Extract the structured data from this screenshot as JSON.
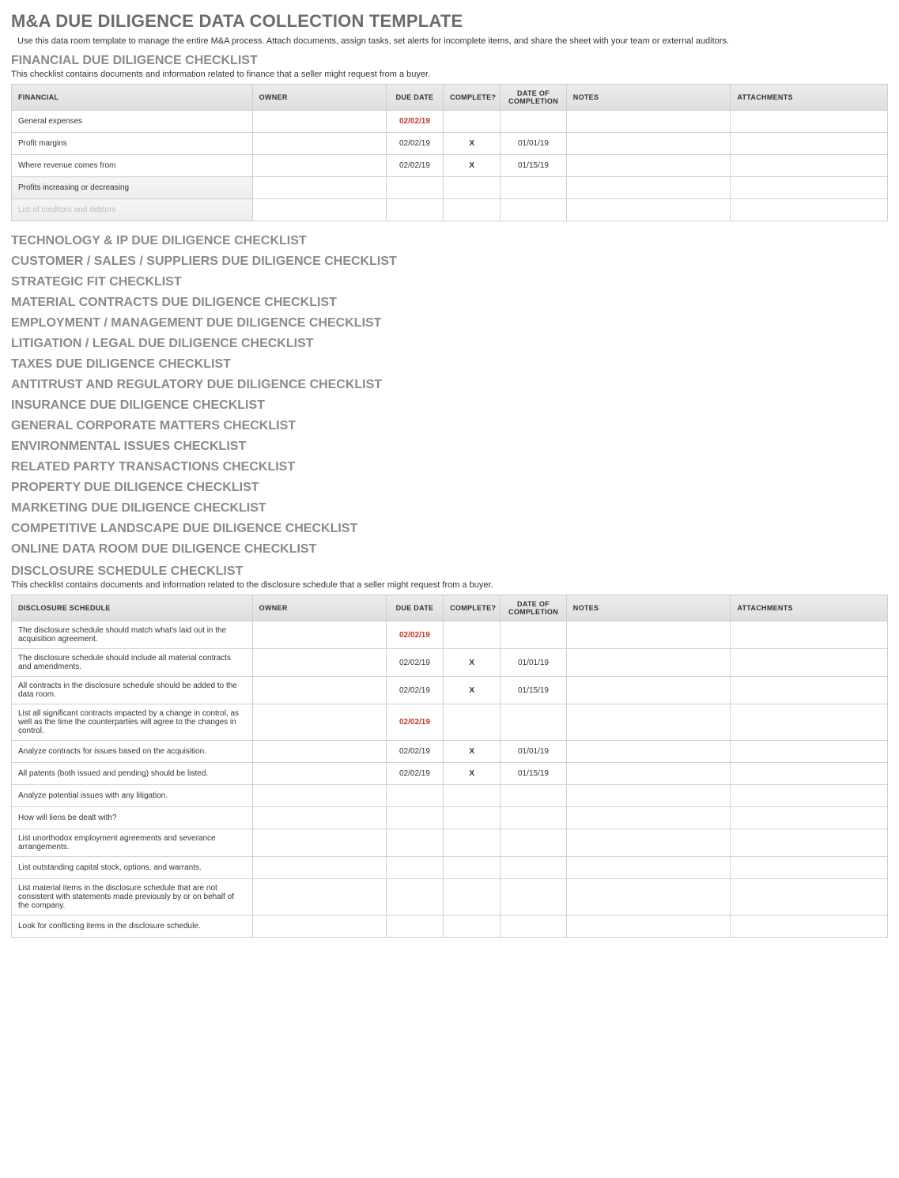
{
  "title": "M&A DUE DILIGENCE DATA COLLECTION TEMPLATE",
  "intro": "Use this data room template to manage the entire M&A process. Attach documents, assign tasks, set alerts for incomplete items, and share the sheet with your team or external auditors.",
  "financial": {
    "heading": "FINANCIAL DUE DILIGENCE CHECKLIST",
    "desc": "This checklist contains documents and information related to finance that a seller might request from a buyer.",
    "columns": {
      "item": "FINANCIAL",
      "owner": "OWNER",
      "due": "DUE DATE",
      "complete": "COMPLETE?",
      "doc": "DATE OF COMPLETION",
      "notes": "NOTES",
      "attach": "ATTACHMENTS"
    },
    "rows": [
      {
        "item": "General expenses",
        "owner": "",
        "due": "02/02/19",
        "due_red": true,
        "complete": "",
        "doc": "",
        "notes": "",
        "attach": ""
      },
      {
        "item": "Profit margins",
        "owner": "",
        "due": "02/02/19",
        "due_red": false,
        "complete": "X",
        "doc": "01/01/19",
        "notes": "",
        "attach": ""
      },
      {
        "item": "Where revenue comes from",
        "owner": "",
        "due": "02/02/19",
        "due_red": false,
        "complete": "X",
        "doc": "01/15/19",
        "notes": "",
        "attach": ""
      },
      {
        "item": "Profits increasing or decreasing",
        "owner": "",
        "due": "",
        "due_red": false,
        "complete": "",
        "doc": "",
        "notes": "",
        "attach": "",
        "grad": true
      },
      {
        "item": "List of creditors and debtors",
        "owner": "",
        "due": "",
        "due_red": false,
        "complete": "",
        "doc": "",
        "notes": "",
        "attach": "",
        "faded": true,
        "grad": true
      }
    ]
  },
  "checklists": [
    "TECHNOLOGY & IP DUE DILIGENCE CHECKLIST",
    "CUSTOMER / SALES / SUPPLIERS DUE DILIGENCE CHECKLIST",
    "STRATEGIC FIT CHECKLIST",
    "MATERIAL CONTRACTS DUE DILIGENCE CHECKLIST",
    "EMPLOYMENT / MANAGEMENT DUE DILIGENCE CHECKLIST",
    "LITIGATION / LEGAL DUE DILIGENCE CHECKLIST",
    "TAXES DUE DILIGENCE CHECKLIST",
    "ANTITRUST AND REGULATORY DUE DILIGENCE CHECKLIST",
    "INSURANCE DUE DILIGENCE CHECKLIST",
    "GENERAL CORPORATE MATTERS CHECKLIST",
    "ENVIRONMENTAL ISSUES CHECKLIST",
    "RELATED PARTY TRANSACTIONS CHECKLIST",
    "PROPERTY DUE DILIGENCE CHECKLIST",
    "MARKETING DUE DILIGENCE CHECKLIST",
    "COMPETITIVE LANDSCAPE DUE DILIGENCE CHECKLIST",
    "ONLINE DATA ROOM DUE DILIGENCE CHECKLIST"
  ],
  "disclosure": {
    "heading": "DISCLOSURE SCHEDULE CHECKLIST",
    "desc": "This checklist contains documents and information related to the disclosure schedule that a seller might request from a buyer.",
    "columns": {
      "item": "DISCLOSURE SCHEDULE",
      "owner": "OWNER",
      "due": "DUE DATE",
      "complete": "COMPLETE?",
      "doc": "DATE OF COMPLETION",
      "notes": "NOTES",
      "attach": "ATTACHMENTS"
    },
    "rows": [
      {
        "item": "The disclosure schedule should match what's laid out in the acquisition agreement.",
        "owner": "",
        "due": "02/02/19",
        "due_red": true,
        "complete": "",
        "doc": "",
        "notes": "",
        "attach": ""
      },
      {
        "item": "The disclosure schedule should include all material contracts and amendments.",
        "owner": "",
        "due": "02/02/19",
        "due_red": false,
        "complete": "X",
        "doc": "01/01/19",
        "notes": "",
        "attach": ""
      },
      {
        "item": "All contracts in the disclosure schedule should be added to the data room.",
        "owner": "",
        "due": "02/02/19",
        "due_red": false,
        "complete": "X",
        "doc": "01/15/19",
        "notes": "",
        "attach": ""
      },
      {
        "item": "List all significant contracts impacted by a change in control, as well as the time the counterparties will agree to the changes in control.",
        "owner": "",
        "due": "02/02/19",
        "due_red": true,
        "complete": "",
        "doc": "",
        "notes": "",
        "attach": ""
      },
      {
        "item": "Analyze contracts for issues based on the acquisition.",
        "owner": "",
        "due": "02/02/19",
        "due_red": false,
        "complete": "X",
        "doc": "01/01/19",
        "notes": "",
        "attach": ""
      },
      {
        "item": "All patents (both issued and pending) should be listed.",
        "owner": "",
        "due": "02/02/19",
        "due_red": false,
        "complete": "X",
        "doc": "01/15/19",
        "notes": "",
        "attach": ""
      },
      {
        "item": "Analyze potential issues with any litigation.",
        "owner": "",
        "due": "",
        "due_red": false,
        "complete": "",
        "doc": "",
        "notes": "",
        "attach": ""
      },
      {
        "item": "How will liens be dealt with?",
        "owner": "",
        "due": "",
        "due_red": false,
        "complete": "",
        "doc": "",
        "notes": "",
        "attach": ""
      },
      {
        "item": "List unorthodox employment agreements and severance arrangements.",
        "owner": "",
        "due": "",
        "due_red": false,
        "complete": "",
        "doc": "",
        "notes": "",
        "attach": ""
      },
      {
        "item": "List outstanding capital stock, options, and warrants.",
        "owner": "",
        "due": "",
        "due_red": false,
        "complete": "",
        "doc": "",
        "notes": "",
        "attach": ""
      },
      {
        "item": "List material items in the disclosure schedule that are not consistent with statements made previously by or on behalf of the company.",
        "owner": "",
        "due": "",
        "due_red": false,
        "complete": "",
        "doc": "",
        "notes": "",
        "attach": ""
      },
      {
        "item": "Look for conflicting items in the disclosure schedule.",
        "owner": "",
        "due": "",
        "due_red": false,
        "complete": "",
        "doc": "",
        "notes": "",
        "attach": ""
      }
    ]
  }
}
